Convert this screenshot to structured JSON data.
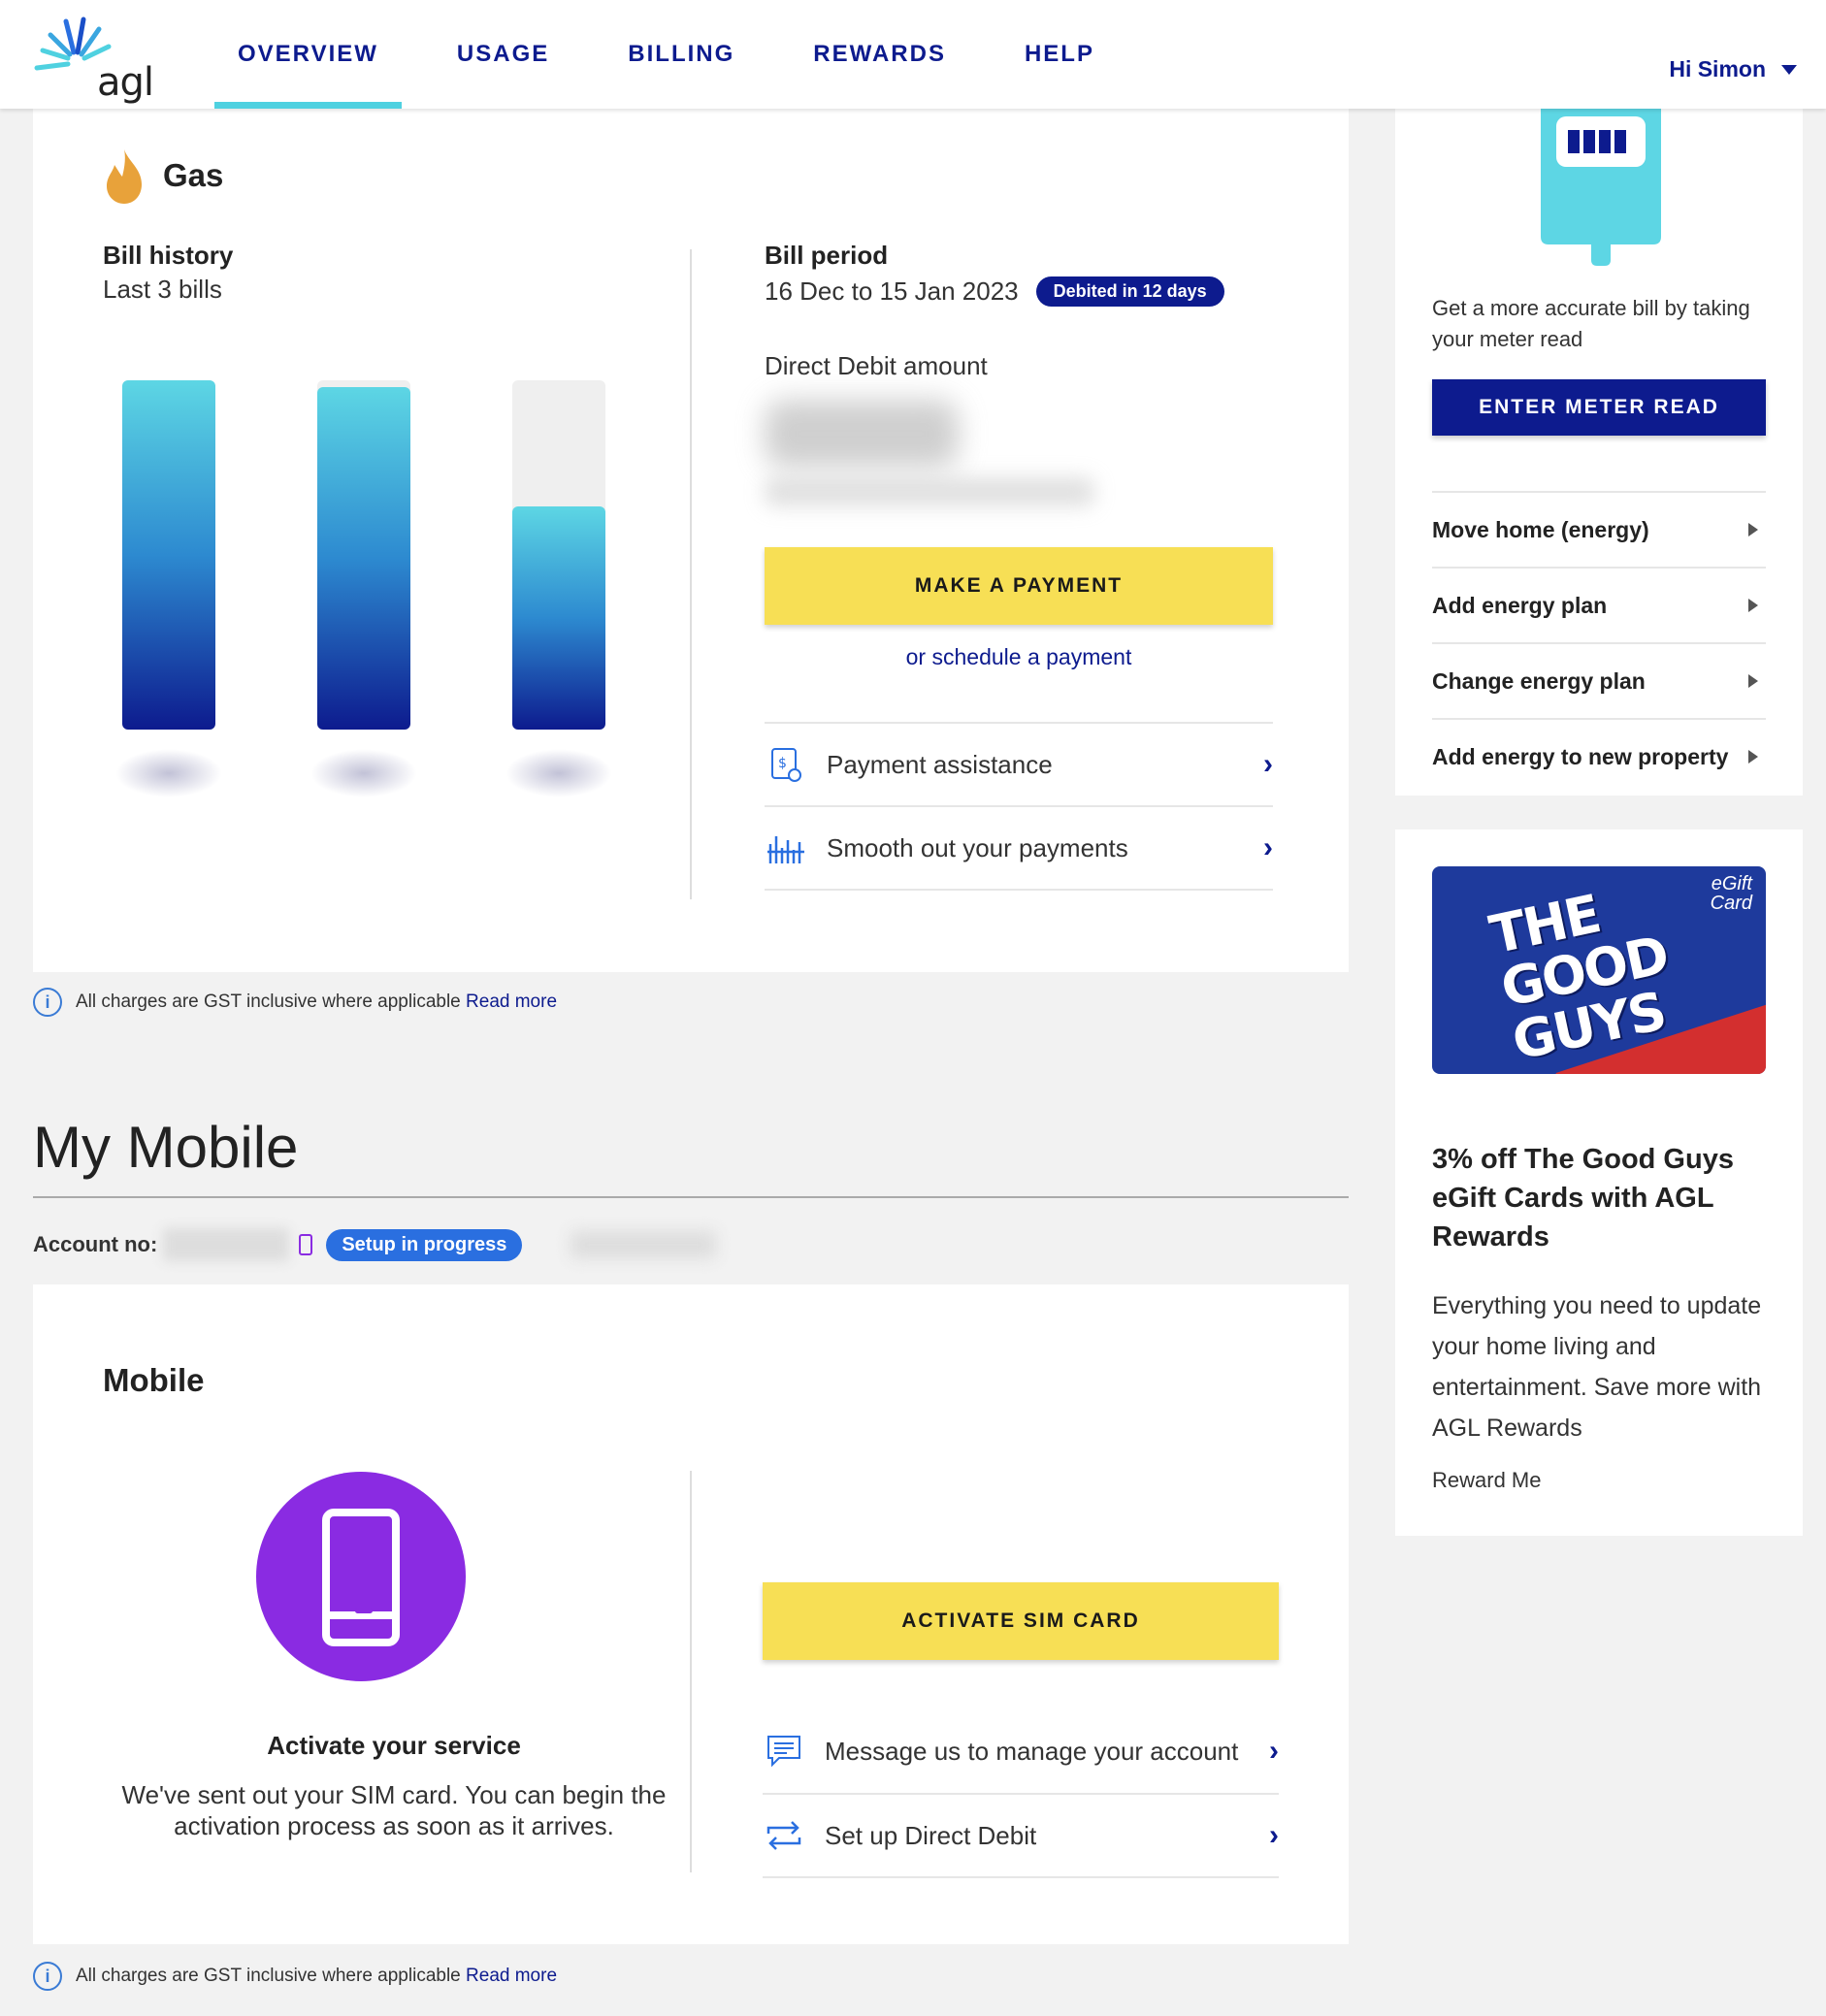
{
  "header": {
    "logo_text": "agl",
    "nav": [
      {
        "label": "OVERVIEW",
        "active": true
      },
      {
        "label": "USAGE",
        "active": false
      },
      {
        "label": "BILLING",
        "active": false
      },
      {
        "label": "REWARDS",
        "active": false
      },
      {
        "label": "HELP",
        "active": false
      }
    ],
    "user_greeting": "Hi Simon"
  },
  "gas": {
    "title": "Gas",
    "bill_history_title": "Bill history",
    "bill_history_sub": "Last 3 bills",
    "bills_relative": [
      1.0,
      0.98,
      0.64
    ],
    "bill_period_title": "Bill period",
    "bill_period_dates": "16 Dec to 15 Jan 2023",
    "debit_badge": "Debited in 12 days",
    "direct_debit_label": "Direct Debit amount",
    "make_payment": "MAKE A PAYMENT",
    "schedule_link": "or schedule a payment",
    "links": [
      {
        "label": "Payment assistance",
        "icon": "payment-assistance-icon"
      },
      {
        "label": "Smooth out your payments",
        "icon": "smooth-payments-icon"
      }
    ]
  },
  "gst_notice": {
    "text": "All charges are GST inclusive where applicable",
    "link": "Read more"
  },
  "mobile_section": {
    "heading": "My Mobile",
    "account_label": "Account no:",
    "status_badge": "Setup in progress",
    "card_title": "Mobile",
    "activate_heading": "Activate your service",
    "activate_text": "We've sent out your SIM card. You can begin the activation process as soon as it arrives.",
    "activate_button": "ACTIVATE SIM CARD",
    "links": [
      {
        "label": "Message us to manage your account",
        "icon": "message-icon"
      },
      {
        "label": "Set up Direct Debit",
        "icon": "direct-debit-icon"
      }
    ]
  },
  "sidebar": {
    "meter_text": "Get a more accurate bill by taking your meter read",
    "meter_button": "ENTER METER READ",
    "actions": [
      "Move home (energy)",
      "Add energy plan",
      "Change energy plan",
      "Add energy to new property"
    ],
    "promo": {
      "image_logo": "THE GOOD GUYS",
      "image_tag": "eGift Card",
      "heading": "3% off The Good Guys eGift Cards with AGL Rewards",
      "text": "Everything you need to update your home living and entertainment. Save more with AGL Rewards",
      "link": "Reward Me"
    }
  },
  "colors": {
    "navy": "#0d1b8e",
    "cyan": "#4fd1e0",
    "yellow": "#f7df55",
    "purple": "#8a2be2",
    "gas_orange": "#e8a23a"
  }
}
